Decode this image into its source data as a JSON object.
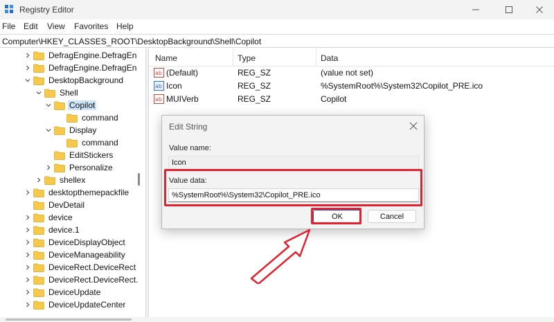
{
  "window": {
    "title": "Registry Editor",
    "controls": [
      "minimize-icon",
      "maximize-icon",
      "close-icon"
    ]
  },
  "menu": {
    "items": [
      {
        "label": "File"
      },
      {
        "label": "Edit"
      },
      {
        "label": "View"
      },
      {
        "label": "Favorites"
      },
      {
        "label": "Help"
      }
    ]
  },
  "address": {
    "path": "Computer\\HKEY_CLASSES_ROOT\\DesktopBackground\\Shell\\Copilot"
  },
  "tree": {
    "items": [
      {
        "label": "DefragEngine.DefragEn",
        "expander": "collapsed"
      },
      {
        "label": "DefragEngine.DefragEn",
        "expander": "collapsed"
      },
      {
        "label": "DesktopBackground",
        "expander": "expanded"
      },
      {
        "label": "Shell",
        "expander": "expanded"
      },
      {
        "label": "Copilot",
        "expander": "expanded",
        "selected": true
      },
      {
        "label": "command",
        "expander": "none"
      },
      {
        "label": "Display",
        "expander": "expanded"
      },
      {
        "label": "command",
        "expander": "none"
      },
      {
        "label": "EditStickers",
        "expander": "none"
      },
      {
        "label": "Personalize",
        "expander": "collapsed"
      },
      {
        "label": "shellex",
        "expander": "collapsed"
      },
      {
        "label": "desktopthemepackfile",
        "expander": "collapsed"
      },
      {
        "label": "DevDetail",
        "expander": "none"
      },
      {
        "label": "device",
        "expander": "collapsed"
      },
      {
        "label": "device.1",
        "expander": "collapsed"
      },
      {
        "label": "DeviceDisplayObject",
        "expander": "collapsed"
      },
      {
        "label": "DeviceManageability",
        "expander": "collapsed"
      },
      {
        "label": "DeviceRect.DeviceRect",
        "expander": "collapsed"
      },
      {
        "label": "DeviceRect.DeviceRect.",
        "expander": "collapsed"
      },
      {
        "label": "DeviceUpdate",
        "expander": "collapsed"
      },
      {
        "label": "DeviceUpdateCenter",
        "expander": "collapsed"
      }
    ]
  },
  "list": {
    "columns": {
      "name": "Name",
      "type": "Type",
      "data": "Data"
    },
    "rows": [
      {
        "name": "(Default)",
        "type": "REG_SZ",
        "data": "(value not set)",
        "icon": "string-value-icon"
      },
      {
        "name": "Icon",
        "type": "REG_SZ",
        "data": "%SystemRoot%\\System32\\Copilot_PRE.ico",
        "icon": "string-value-icon"
      },
      {
        "name": "MUIVerb",
        "type": "REG_SZ",
        "data": "Copilot",
        "icon": "string-value-icon"
      }
    ]
  },
  "dialog": {
    "title": "Edit String",
    "value_name_label": "Value name:",
    "value_name": "Icon",
    "value_data_label": "Value data:",
    "value_data": "%SystemRoot%\\System32\\Copilot_PRE.ico",
    "ok_label": "OK",
    "cancel_label": "Cancel"
  },
  "colors": {
    "annotation_red": "#e4202f",
    "folder_yellow": "#f6c94a",
    "selection_blue": "#cce4f7",
    "accent": "#0067c0"
  }
}
